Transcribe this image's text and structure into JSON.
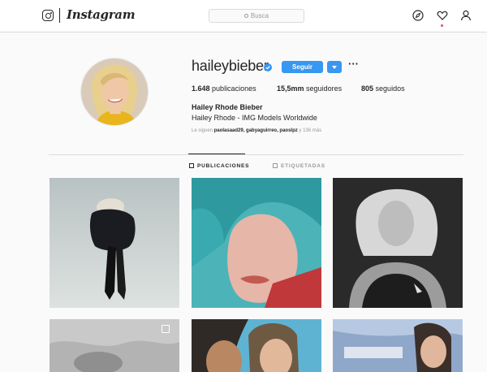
{
  "header": {
    "logo_text": "Instagram",
    "search_placeholder": "Busca"
  },
  "profile": {
    "username": "haileybieber",
    "follow_label": "Seguir",
    "more_label": "···",
    "stats": {
      "posts_count": "1.648",
      "posts_label": "publicaciones",
      "followers_count": "15,5mm",
      "followers_label": "seguidores",
      "following_count": "805",
      "following_label": "seguidos"
    },
    "full_name": "Hailey Rhode Bieber",
    "bio": "Hailey Rhode - IMG Models Worldwide",
    "followed_by_prefix": "Le siguen ",
    "followed_by_names": "paolasaad29, gabyaguirreo, paoslpz",
    "followed_by_suffix": " y 136 más"
  },
  "tabs": {
    "posts": "PUBLICACIONES",
    "tagged": "ETIQUETADAS"
  },
  "colors": {
    "accent": "#3897f0",
    "border": "#dbdbdb",
    "text": "#262626",
    "muted": "#999999",
    "notification": "#ed4956"
  },
  "icons": {
    "logo": "instagram-glyph-icon",
    "search": "search-icon",
    "explore": "compass-icon",
    "activity": "heart-icon",
    "profile": "person-icon",
    "verified": "verified-badge-icon",
    "dropdown": "caret-down-icon",
    "posts_tab": "grid-icon",
    "tagged_tab": "tag-icon",
    "multi": "multiple-posts-icon"
  }
}
